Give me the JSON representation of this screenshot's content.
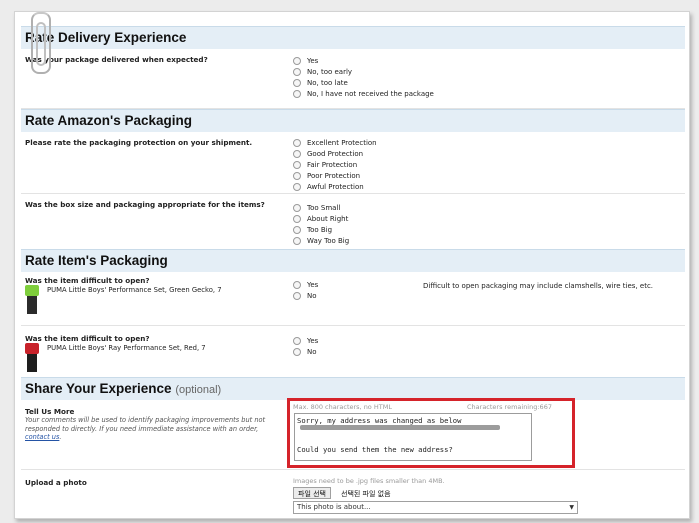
{
  "sections": {
    "delivery": {
      "title": "Rate Delivery Experience"
    },
    "packaging": {
      "title": "Rate Amazon's Packaging"
    },
    "item_packaging": {
      "title": "Rate Item's Packaging"
    },
    "share": {
      "title": "Share Your Experience",
      "optional": "(optional)"
    }
  },
  "delivery_q": {
    "label": "Was your package delivered when expected?",
    "options": [
      "Yes",
      "No, too early",
      "No, too late",
      "No, I have not received the package"
    ]
  },
  "protection_q": {
    "label": "Please rate the packaging protection on your shipment.",
    "options": [
      "Excellent Protection",
      "Good Protection",
      "Fair Protection",
      "Poor Protection",
      "Awful Protection"
    ]
  },
  "size_q": {
    "label": "Was the box size and packaging appropriate for the items?",
    "options": [
      "Too Small",
      "About Right",
      "Too Big",
      "Way Too Big"
    ]
  },
  "items": [
    {
      "question": "Was the item difficult to open?",
      "name": "PUMA Little Boys' Performance Set, Green Gecko, 7",
      "options": [
        "Yes",
        "No"
      ],
      "note": "Difficult to open packaging may include clamshells, wire ties, etc.",
      "colors": {
        "top": "#7fce3c",
        "bottom": "#2b2b2b"
      }
    },
    {
      "question": "Was the item difficult to open?",
      "name": "PUMA Little Boys' Ray Performance Set, Red, 7",
      "options": [
        "Yes",
        "No"
      ],
      "colors": {
        "top": "#c8222a",
        "bottom": "#1e1e1e"
      }
    }
  ],
  "tell_us": {
    "label": "Tell Us More",
    "desc": "Your comments will be used to identify packaging improvements but not responded to directly. If you need immediate assistance with an order,",
    "contact": "contact us",
    "period": ".",
    "max": "Max. 800 characters, no HTML",
    "remaining": "Characters remaining:667",
    "value": "Sorry, my address was changed as below\n\n\nCould you send them the new address?"
  },
  "upload": {
    "label": "Upload a photo",
    "hint": "Images need to be .jpg files smaller than 4MB.",
    "button": "파일 선택",
    "no_file": "선택된 파일 없음",
    "select_value": "This photo is about..."
  },
  "colors": {
    "accent_red": "#d5232a",
    "header_bg": "#e4eef6",
    "link": "#2453a5"
  }
}
